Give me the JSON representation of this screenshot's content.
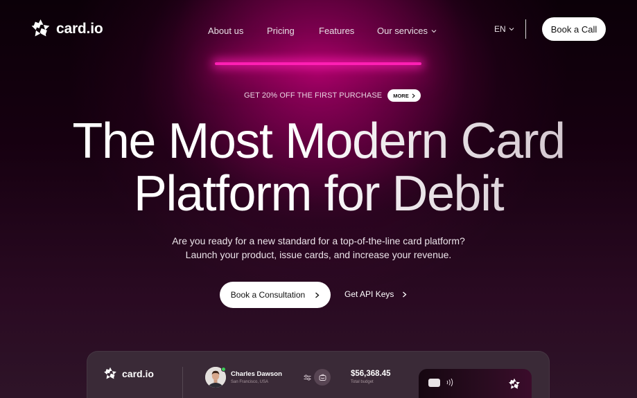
{
  "brand": {
    "name": "card.io",
    "logo_icon": "star-logo-icon"
  },
  "nav": {
    "items": [
      {
        "label": "About us"
      },
      {
        "label": "Pricing"
      },
      {
        "label": "Features"
      },
      {
        "label": "Our services",
        "icon": "chevron-down-icon"
      }
    ],
    "language": "EN",
    "cta": "Book a Call"
  },
  "promo": {
    "text": "GET 20% OFF THE FIRST PURCHASE",
    "button": "MORE"
  },
  "hero": {
    "title_line1": "The Most Modern Card",
    "title_line2": "Platform for Debit",
    "subtitle_line1": "Are you ready for a new standard for a top-of-the-line card platform?",
    "subtitle_line2": "Launch your product, issue cards, and increase your revenue.",
    "primary_button": "Book a Consultation",
    "secondary_button": "Get API Keys"
  },
  "preview": {
    "brand": "card.io",
    "user": {
      "name": "Charles Dawson",
      "location": "San Francisco, USA"
    },
    "budget": {
      "value": "$56,368.45",
      "label": "Total budget"
    }
  },
  "colors": {
    "accent": "#ff1fb4",
    "background": "#160010",
    "button_bg": "#ffffff",
    "online_status": "#3ccf5a"
  }
}
